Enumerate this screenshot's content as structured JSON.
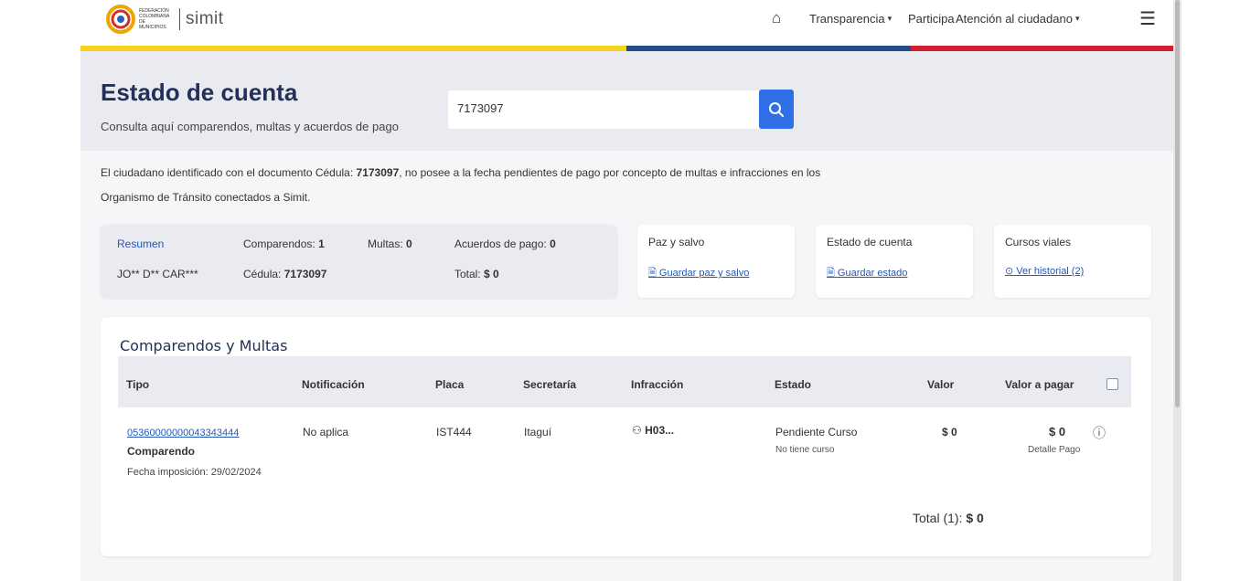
{
  "header": {
    "logo_text": "FEDERACIÓN COLOMBIANA DE MUNICIPIOS",
    "logo_brand": "simit",
    "nav": [
      {
        "label": "Transparencia",
        "caret": "▾"
      },
      {
        "label": "Participa"
      },
      {
        "label": "Atención al ciudadano",
        "caret": "▾"
      }
    ],
    "home_icon": "⌂",
    "menu_icon": "☰",
    "stripe_colors": {
      "yellow": "#f7d21c",
      "blue": "#224a8c",
      "red": "#cf1f2c"
    }
  },
  "hero": {
    "title": "Estado de cuenta",
    "subtitle": "Consulta aquí comparendos, multas y acuerdos de pago",
    "search_value": "7173097"
  },
  "notice": {
    "line1_pre": "El ciudadano identificado con el documento Cédula: ",
    "doc": "7173097",
    "line1_post": ", no posee a la fecha pendientes de pago por concepto de multas e infracciones en los",
    "line2": "Organismo de Tránsito conectados a Simit."
  },
  "summary": {
    "resumen": "Resumen",
    "name": "JO** D** CAR***",
    "comparendos_label": "Comparendos:",
    "comparendos_value": "1",
    "cedula_label": "Cédula:",
    "cedula_value": "7173097",
    "multas_label": "Multas:",
    "multas_value": "0",
    "acuerdos_label": "Acuerdos de pago:",
    "acuerdos_value": "0",
    "total_label": "Total:",
    "total_value": "$ 0"
  },
  "cards": [
    {
      "title": "Paz y salvo",
      "link": "Guardar paz y salvo",
      "icon": "🗎"
    },
    {
      "title": "Estado de cuenta",
      "link": "Guardar estado",
      "icon": "🗎"
    },
    {
      "title": "Cursos viales",
      "link": "Ver historial (2)",
      "icon": "⊙"
    }
  ],
  "table": {
    "title": "Comparendos y Multas",
    "headers": [
      "Tipo",
      "Notificación",
      "Placa",
      "Secretaría",
      "Infracción",
      "Estado",
      "Valor",
      "Valor a pagar"
    ],
    "row": {
      "numero": "05360000000043343444",
      "tipo": "Comparendo",
      "fecha": "Fecha imposición: 29/02/2024",
      "notificacion": "No aplica",
      "placa": "IST444",
      "secretaria": "Itaguí",
      "infraccion": "H03...",
      "estado": "Pendiente Curso",
      "estado_sub": "No tiene curso",
      "valor": "$ 0",
      "valor_pagar": "$ 0",
      "detalle": "Detalle Pago",
      "info_icon": "ⓘ",
      "person_icon": "⚇"
    },
    "total_label": "Total (1):",
    "total_value": "$ 0"
  }
}
